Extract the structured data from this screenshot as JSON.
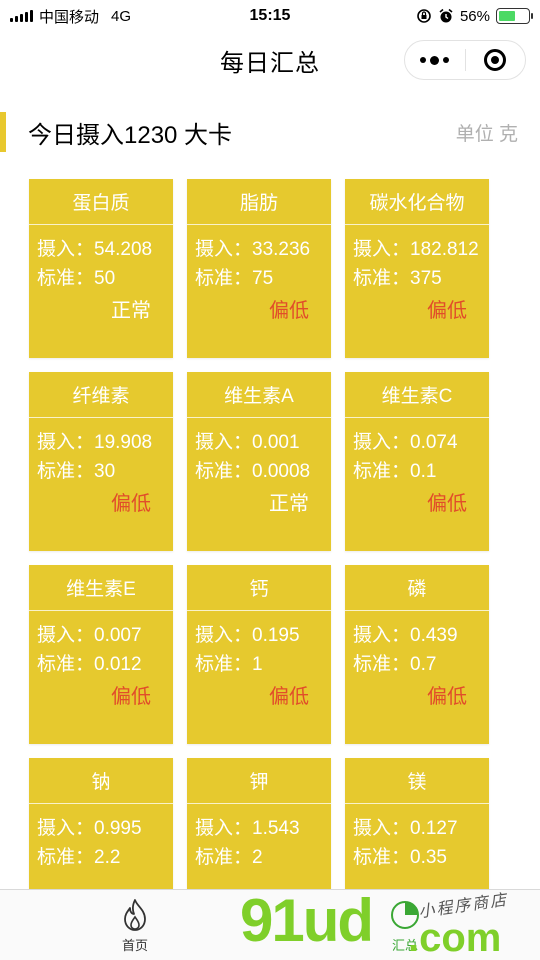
{
  "status_bar": {
    "carrier": "中国移动",
    "network": "4G",
    "time": "15:15",
    "battery_percent": "56%",
    "battery_level": 0.56
  },
  "nav": {
    "title": "每日汇总"
  },
  "header": {
    "intake_text": "今日摄入1230 大卡",
    "unit_text": "单位 克"
  },
  "card_labels": {
    "intake": "摄入：",
    "standard": "标准："
  },
  "nutrients": [
    {
      "name": "蛋白质",
      "intake": "54.208",
      "standard": "50",
      "status": "正常"
    },
    {
      "name": "脂肪",
      "intake": "33.236",
      "standard": "75",
      "status": "偏低"
    },
    {
      "name": "碳水化合物",
      "intake": "182.812",
      "standard": "375",
      "status": "偏低"
    },
    {
      "name": "纤维素",
      "intake": "19.908",
      "standard": "30",
      "status": "偏低"
    },
    {
      "name": "维生素A",
      "intake": "0.001",
      "standard": "0.0008",
      "status": "正常"
    },
    {
      "name": "维生素C",
      "intake": "0.074",
      "standard": "0.1",
      "status": "偏低"
    },
    {
      "name": "维生素E",
      "intake": "0.007",
      "standard": "0.012",
      "status": "偏低"
    },
    {
      "name": "钙",
      "intake": "0.195",
      "standard": "1",
      "status": "偏低"
    },
    {
      "name": "磷",
      "intake": "0.439",
      "standard": "0.7",
      "status": "偏低"
    },
    {
      "name": "钠",
      "intake": "0.995",
      "standard": "2.2",
      "status": ""
    },
    {
      "name": "钾",
      "intake": "1.543",
      "standard": "2",
      "status": ""
    },
    {
      "name": "镁",
      "intake": "0.127",
      "standard": "0.35",
      "status": ""
    }
  ],
  "tabs": [
    {
      "label": "首页",
      "icon": "flame-icon",
      "active": false
    },
    {
      "label": "汇总",
      "icon": "summary-icon",
      "active": true
    }
  ],
  "watermark": {
    "brand": "91ud",
    "domain": ".com",
    "tagline": "小程序商店"
  },
  "colors": {
    "card_bg": "#e6c92e",
    "accent": "#e8c82e",
    "status_low": "#e14d2a",
    "status_ok": "#ffffff",
    "tab_active": "#3aa734"
  }
}
